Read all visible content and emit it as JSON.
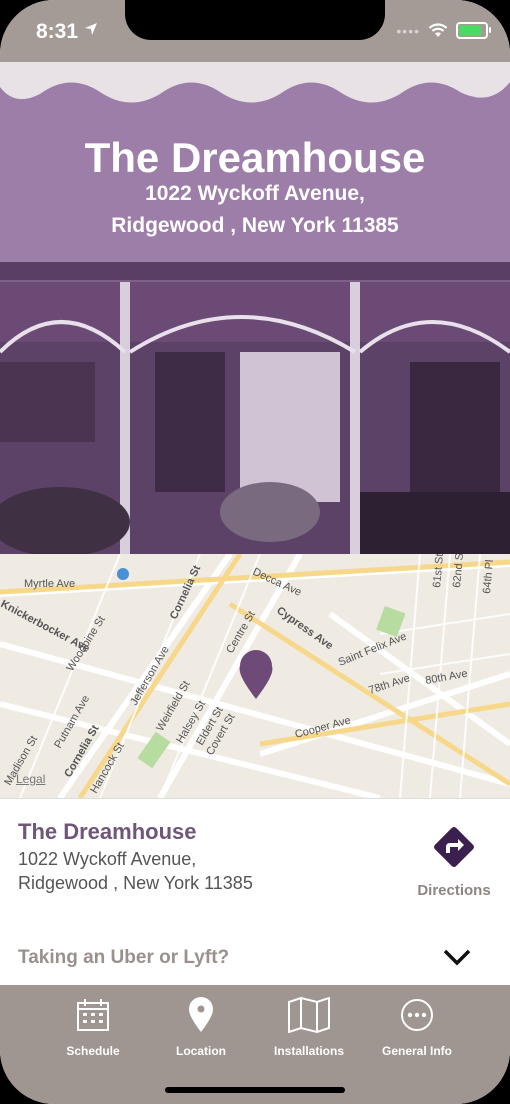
{
  "status": {
    "time": "8:31",
    "icons": [
      "location-arrow-icon",
      "wifi-icon",
      "battery-icon"
    ],
    "battery_level": 0.8
  },
  "hero": {
    "title": "The Dreamhouse",
    "address_line1": "1022 Wyckoff Avenue,",
    "address_line2": "Ridgewood , New York 11385",
    "tint_color": "#7e5f88"
  },
  "map": {
    "legal": "Legal",
    "streets": [
      "Myrtle Ave",
      "Cornelia St",
      "Decca Ave",
      "Knickerbocker Ave",
      "Woodbine St",
      "Centre St",
      "Cypress Ave",
      "Jefferson Ave",
      "Saint Felix Ave",
      "78th Ave",
      "80th Ave",
      "Weirfield St",
      "Halsey St",
      "Eldert St",
      "Covert St",
      "Cooper Ave",
      "Putnam Ave",
      "Madison St",
      "Hancock St",
      "61st St",
      "62nd St",
      "64th Pl"
    ],
    "pin_color": "#6e4a78"
  },
  "venue": {
    "name": "The Dreamhouse",
    "address_line1": "1022 Wyckoff Avenue,",
    "address_line2": "Ridgewood , New York 11385",
    "directions_label": "Directions"
  },
  "uber": {
    "label": "Taking an Uber or Lyft?"
  },
  "tabs": [
    {
      "label": "Schedule",
      "icon": "calendar-icon"
    },
    {
      "label": "Location",
      "icon": "map-pin-icon"
    },
    {
      "label": "Installations",
      "icon": "map-icon"
    },
    {
      "label": "General Info",
      "icon": "more-icon"
    }
  ],
  "colors": {
    "accent": "#6e5779",
    "tabbar": "#9f9591",
    "statusbar": "#a49a96"
  }
}
